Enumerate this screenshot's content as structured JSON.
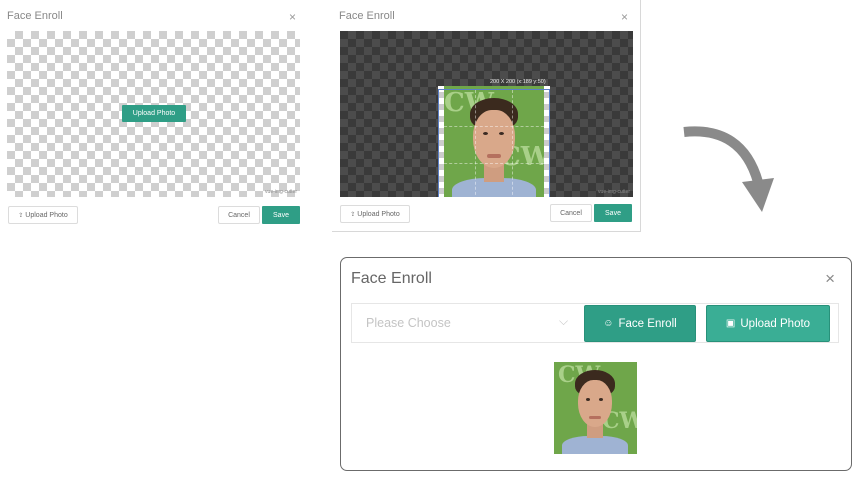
{
  "dialog_empty": {
    "title": "Face Enroll",
    "close_icon": "×",
    "center_button": "Upload Photo",
    "watermark": "vue-img-cutter",
    "upload_button": "Upload Photo",
    "upload_icon": "⇪",
    "cancel_button": "Cancel",
    "save_button": "Save"
  },
  "dialog_crop": {
    "title": "Face Enroll",
    "close_icon": "×",
    "crop_dimensions": "200 X 200 (x:189 y:50)",
    "watermark": "vue-img-cutter",
    "upload_button": "Upload Photo",
    "upload_icon": "⇪",
    "cancel_button": "Cancel",
    "save_button": "Save"
  },
  "dialog_result": {
    "title": "Face Enroll",
    "close_icon": "×",
    "select_placeholder": "Please Choose",
    "select_chevron": "⌵",
    "face_enroll_button": "Face Enroll",
    "face_enroll_icon": "☺",
    "upload_button": "Upload Photo",
    "upload_icon": "▣"
  },
  "photo_text": "CW",
  "colors": {
    "accent": "#2f9e86",
    "photo_background": "#6fa64a",
    "flow_arrow": "#8a8a8a"
  },
  "icons": {
    "flow": "curved-arrow-down-icon"
  }
}
